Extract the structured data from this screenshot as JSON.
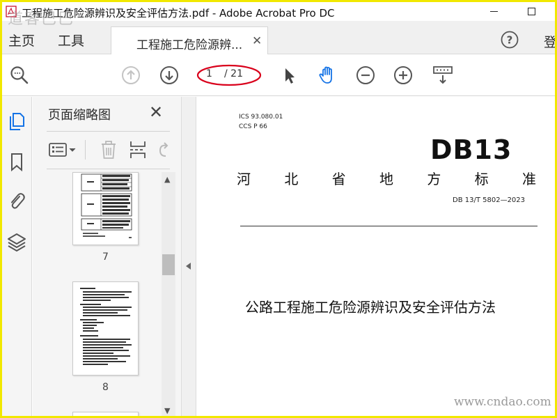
{
  "window": {
    "title": "工程施工危险源辨识及安全评估方法.pdf - Adobe Acrobat Pro DC",
    "corner_watermark": "道客巴巴"
  },
  "menu": {
    "home": "主页",
    "tools": "工具",
    "doc_tab": "工程施工危险源辨...",
    "login": "登"
  },
  "toolbar": {
    "page_current": "1",
    "page_total": "/ 21"
  },
  "thumbnails": {
    "title": "页面缩略图",
    "pages": [
      {
        "label": "7"
      },
      {
        "label": "8"
      }
    ]
  },
  "document": {
    "ics": "ICS  93.080.01",
    "ccs": "CCS  P 66",
    "logo": "DB13",
    "std_chars": [
      "河",
      "北",
      "省",
      "地",
      "方",
      "标",
      "准"
    ],
    "std_number": "DB 13/T  5802—2023",
    "title": "公路工程施工危险源辨识及安全评估方法",
    "watermark": "www.cndao.com"
  },
  "colors": {
    "frame": "#f1e800",
    "icon_gray": "#555555",
    "icon_active_blue": "#1473e6",
    "annotation_red": "#d9001b"
  }
}
